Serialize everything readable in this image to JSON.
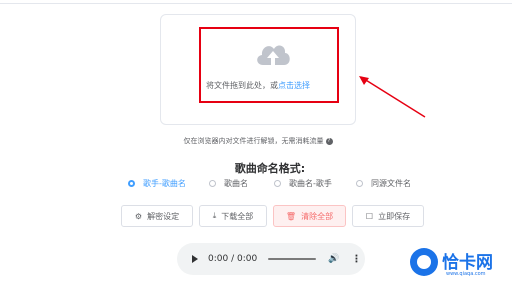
{
  "upload": {
    "text": "将文件拖到此处，或",
    "link": "点击选择",
    "icon": "cloud-upload-icon"
  },
  "note": {
    "text": "仅在浏览器内对文件进行解锁，无需消耗流量",
    "icon": "question-circle-icon"
  },
  "naming": {
    "title": "歌曲命名格式:",
    "options": [
      {
        "label": "歌手-歌曲名",
        "checked": true
      },
      {
        "label": "歌曲名",
        "checked": false
      },
      {
        "label": "歌曲名-歌手",
        "checked": false
      },
      {
        "label": "同源文件名",
        "checked": false
      }
    ]
  },
  "buttons": {
    "decrypt_settings": "解密设定",
    "download_all": "下载全部",
    "clear_all": "清除全部",
    "save_now": "立即保存"
  },
  "player": {
    "time": "0:00 / 0:00"
  },
  "watermark": {
    "brand": "恰卡网",
    "url": "www.qiaqa.com"
  },
  "colors": {
    "accent": "#409eff",
    "highlight_box": "#e60012",
    "danger": "#f56c6c"
  }
}
